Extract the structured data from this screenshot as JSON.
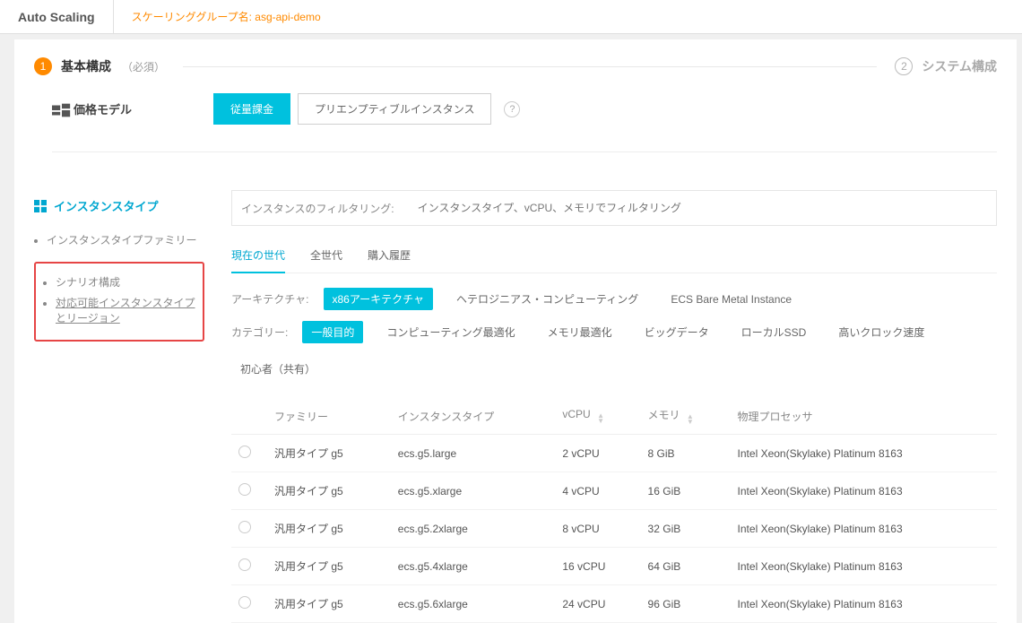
{
  "topbar": {
    "brand": "Auto Scaling",
    "sg_label": "スケーリンググループ名: asg-api-demo"
  },
  "steps": {
    "step1_num": "1",
    "step1_title": "基本構成",
    "step1_sub": "（必須）",
    "step2_num": "2",
    "step2_title": "システム構成"
  },
  "pricing": {
    "label": "価格モデル",
    "payg": "従量課金",
    "preempt": "プリエンプティブルインスタンス"
  },
  "sidebar": {
    "title": "インスタンスタイプ",
    "items": [
      "インスタンスタイプファミリー",
      "シナリオ構成",
      "対応可能インスタンスタイプとリージョン"
    ]
  },
  "filter": {
    "label": "インスタンスのフィルタリング:",
    "placeholder": "インスタンスタイプ、vCPU、メモリでフィルタリング"
  },
  "tabs": {
    "current": "現在の世代",
    "all": "全世代",
    "history": "購入履歴"
  },
  "arch": {
    "label": "アーキテクチャ:",
    "x86": "x86アーキテクチャ",
    "hetero": "ヘテロジニアス・コンピューティング",
    "bare": "ECS Bare Metal Instance"
  },
  "category": {
    "label": "カテゴリー:",
    "opts": [
      "一般目的",
      "コンピューティング最適化",
      "メモリ最適化",
      "ビッグデータ",
      "ローカルSSD",
      "高いクロック速度",
      "初心者（共有）"
    ]
  },
  "table": {
    "headers": {
      "family": "ファミリー",
      "type": "インスタンスタイプ",
      "vcpu": "vCPU",
      "memory": "メモリ",
      "cpu": "物理プロセッサ"
    },
    "rows": [
      {
        "family": "汎用タイプ g5",
        "type": "ecs.g5.large",
        "vcpu": "2 vCPU",
        "mem": "8 GiB",
        "cpu": "Intel Xeon(Skylake) Platinum 8163"
      },
      {
        "family": "汎用タイプ g5",
        "type": "ecs.g5.xlarge",
        "vcpu": "4 vCPU",
        "mem": "16 GiB",
        "cpu": "Intel Xeon(Skylake) Platinum 8163"
      },
      {
        "family": "汎用タイプ g5",
        "type": "ecs.g5.2xlarge",
        "vcpu": "8 vCPU",
        "mem": "32 GiB",
        "cpu": "Intel Xeon(Skylake) Platinum 8163"
      },
      {
        "family": "汎用タイプ g5",
        "type": "ecs.g5.4xlarge",
        "vcpu": "16 vCPU",
        "mem": "64 GiB",
        "cpu": "Intel Xeon(Skylake) Platinum 8163"
      },
      {
        "family": "汎用タイプ g5",
        "type": "ecs.g5.6xlarge",
        "vcpu": "24 vCPU",
        "mem": "96 GiB",
        "cpu": "Intel Xeon(Skylake) Platinum 8163"
      }
    ]
  }
}
